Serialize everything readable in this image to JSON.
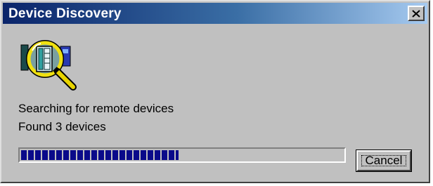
{
  "window": {
    "title": "Device Discovery",
    "close_glyph": "×",
    "icon": "magnifier-over-device-icon"
  },
  "status": {
    "line1": "Searching for remote devices",
    "line2": "Found 3 devices"
  },
  "progress": {
    "fraction": 0.49
  },
  "buttons": {
    "cancel_label": "Cancel"
  },
  "colors": {
    "titlebar_start": "#0a246a",
    "titlebar_end": "#a6caf0",
    "progress_fill": "#0a0a8a",
    "face": "#c0c0c0"
  }
}
